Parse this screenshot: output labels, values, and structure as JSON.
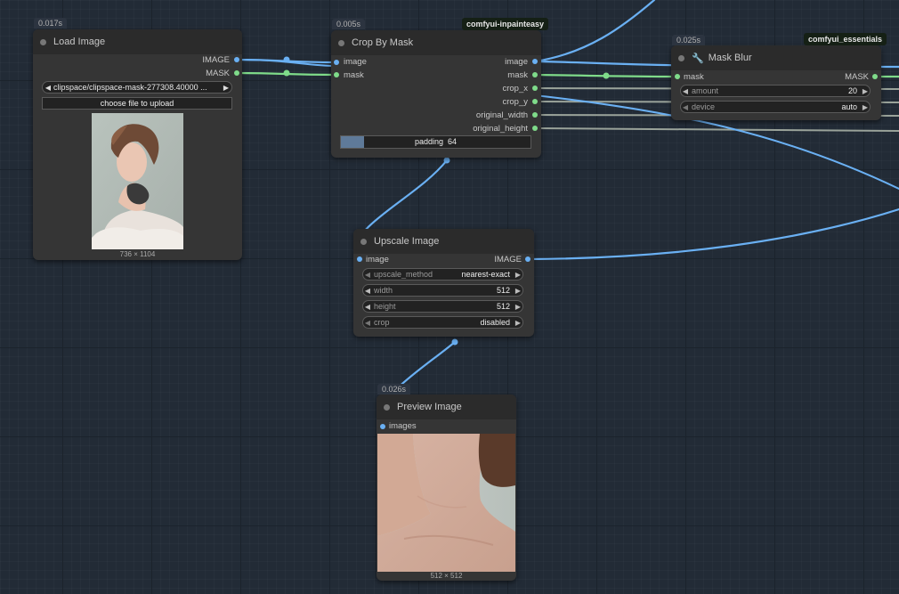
{
  "colors": {
    "image_wire": "#6ab0f3",
    "mask_wire": "#7fdb8a",
    "float_wire": "#9aa39a",
    "canvas": "#222b36",
    "node": "#353535"
  },
  "load_image": {
    "timing": "0.017s",
    "title": "Load Image",
    "outputs": {
      "image": "IMAGE",
      "mask": "MASK"
    },
    "file": "clipspace/clipspace-mask-277308.40000 ...",
    "upload_label": "choose file to upload",
    "dims": "736 × 1104"
  },
  "crop_by_mask": {
    "timing": "0.005s",
    "badge": "comfyui-inpainteasy",
    "title": "Crop By Mask",
    "inputs": {
      "image": "image",
      "mask": "mask"
    },
    "outputs": [
      "image",
      "mask",
      "crop_x",
      "crop_y",
      "original_width",
      "original_height"
    ],
    "padding_label": "padding",
    "padding_value": "64",
    "padding_fraction": 0.12
  },
  "mask_blur": {
    "timing": "0.025s",
    "badge": "comfyui_essentials",
    "title": "Mask Blur",
    "title_icon": "wrench-icon",
    "input": "mask",
    "output": "MASK",
    "amount_label": "amount",
    "amount_value": "20",
    "device_label": "device",
    "device_value": "auto"
  },
  "upscale_image": {
    "title": "Upscale Image",
    "input": "image",
    "output": "IMAGE",
    "widgets": [
      {
        "label": "upscale_method",
        "value": "nearest-exact"
      },
      {
        "label": "width",
        "value": "512"
      },
      {
        "label": "height",
        "value": "512"
      },
      {
        "label": "crop",
        "value": "disabled"
      }
    ]
  },
  "preview_image": {
    "timing": "0.026s",
    "title": "Preview Image",
    "input": "images",
    "dims": "512 × 512"
  }
}
